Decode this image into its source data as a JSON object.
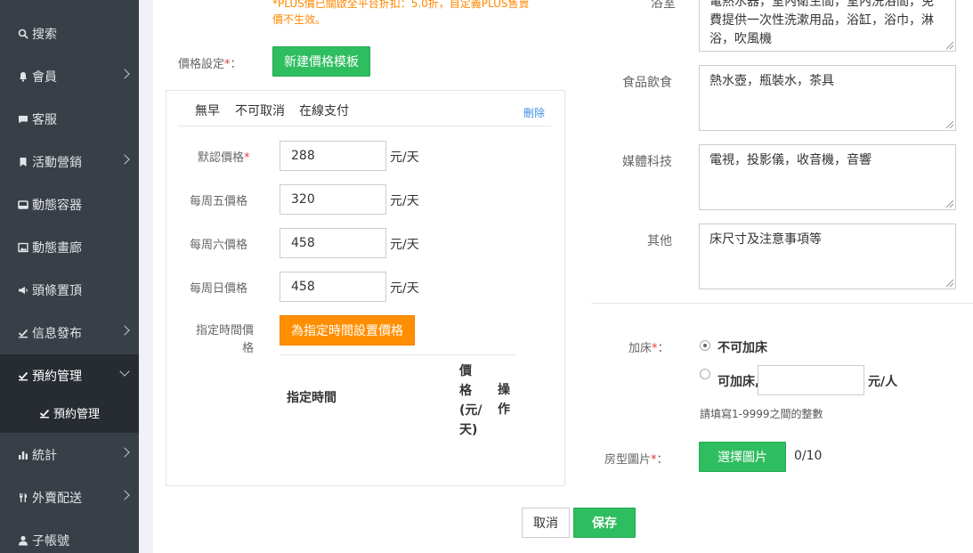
{
  "sidebar": {
    "items": [
      {
        "label": "搜索",
        "icon": "search-icon"
      },
      {
        "label": "會員",
        "icon": "bell-icon"
      },
      {
        "label": "客服",
        "icon": "chat-icon"
      },
      {
        "label": "活動營銷",
        "icon": "bookmark-icon"
      },
      {
        "label": "動態容器",
        "icon": "inbox-icon"
      },
      {
        "label": "動態畫廊",
        "icon": "image-icon"
      },
      {
        "label": "頭條置頂",
        "icon": "megaphone-icon"
      },
      {
        "label": "信息發布",
        "icon": "check-icon"
      },
      {
        "label": "預約管理",
        "icon": "check-icon"
      },
      {
        "label": "統計",
        "icon": "bar-chart-icon"
      },
      {
        "label": "外賣配送",
        "icon": "utensils-icon"
      },
      {
        "label": "子帳號",
        "icon": "user-icon"
      }
    ],
    "sub_item": "預約管理"
  },
  "notice": {
    "line1": "*PLUS價已關啟全平台折扣：5.0折，自定義PLUS售賣",
    "line2": "價不生效。"
  },
  "price_settings": {
    "label": "價格設定",
    "required_mark": "*",
    "colon": "：",
    "new_template_button": "新建價格模板"
  },
  "template": {
    "tags": [
      "無早",
      "不可取消",
      "在線支付"
    ],
    "delete_link": "刪除",
    "rows": [
      {
        "label": "默認價格",
        "required": "*",
        "value": "288",
        "unit": "元/天"
      },
      {
        "label": "每周五價格",
        "value": "320",
        "unit": "元/天"
      },
      {
        "label": "每周六價格",
        "value": "458",
        "unit": "元/天"
      },
      {
        "label": "每周日價格",
        "value": "458",
        "unit": "元/天"
      }
    ],
    "special_label_line1": "指定時間價",
    "special_label_line2": "格",
    "special_button": "為指定時間設置價格",
    "table": {
      "col_time": "指定時間",
      "col_price": [
        "價",
        "格",
        "(元/",
        "天)"
      ],
      "col_action": [
        "操",
        "作"
      ]
    }
  },
  "facilities": {
    "bathroom": {
      "label": "浴室",
      "value": "電熱水器，室內衛生間，室內洗浴間，免費提供一次性洗漱用品，浴缸，浴巾，淋浴，吹風機"
    },
    "food": {
      "label": "食品飲食",
      "value": "熱水壺，瓶裝水，茶具"
    },
    "media": {
      "label": "媒體科技",
      "value": "電視，投影儀，收音機，音響"
    },
    "other": {
      "label": "其他",
      "value": "床尺寸及注意事項等"
    }
  },
  "extra_bed": {
    "label": "加床",
    "required_mark": "*",
    "colon": "：",
    "option_no": "不可加床",
    "option_yes": "可加床,",
    "unit": "元/人",
    "hint": "請填寫1-9999之間的整數",
    "input_value": ""
  },
  "room_images": {
    "label": "房型圖片",
    "required_mark": "*",
    "colon": "：",
    "button": "選擇圖片",
    "count": "0/10"
  },
  "footer": {
    "cancel": "取消",
    "save": "保存"
  },
  "colors": {
    "sidebar_bg": "#383f47",
    "sidebar_active": "#262c32",
    "green": "#2ebd5f",
    "orange": "#ff8f00",
    "required": "#e4393c",
    "notice": "#ff8800",
    "link": "#3a8ee6"
  }
}
